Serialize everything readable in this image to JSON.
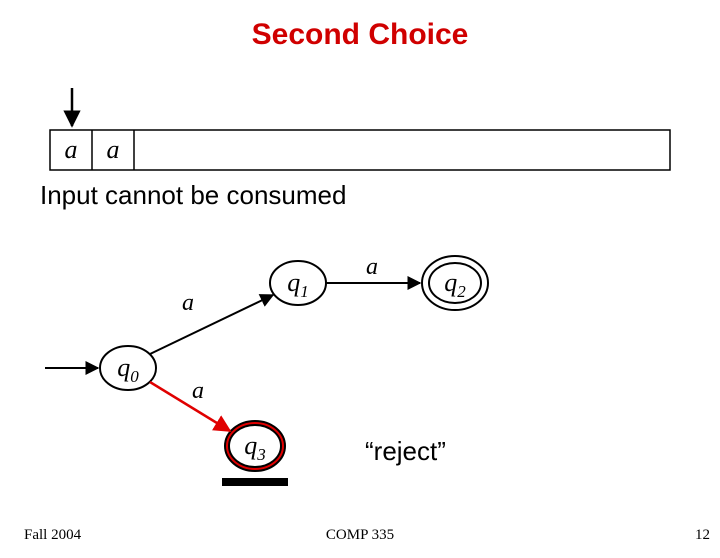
{
  "title": "Second Choice",
  "caption": "Input cannot be consumed",
  "reject_label": "“reject”",
  "tape": {
    "cells": [
      "a",
      "a"
    ]
  },
  "states": {
    "q0": {
      "label": "q",
      "sub": "0"
    },
    "q1": {
      "label": "q",
      "sub": "1"
    },
    "q2": {
      "label": "q",
      "sub": "2",
      "accepting": true
    },
    "q3": {
      "label": "q",
      "sub": "3",
      "highlighted": true
    }
  },
  "transitions": [
    {
      "from": "start",
      "to": "q0",
      "label": ""
    },
    {
      "from": "q0",
      "to": "q1",
      "label": "a"
    },
    {
      "from": "q1",
      "to": "q2",
      "label": "a"
    },
    {
      "from": "q0",
      "to": "q3",
      "label": "a",
      "highlighted": true
    }
  ],
  "footer": {
    "left": "Fall 2004",
    "center": "COMP 335",
    "right": "12"
  }
}
